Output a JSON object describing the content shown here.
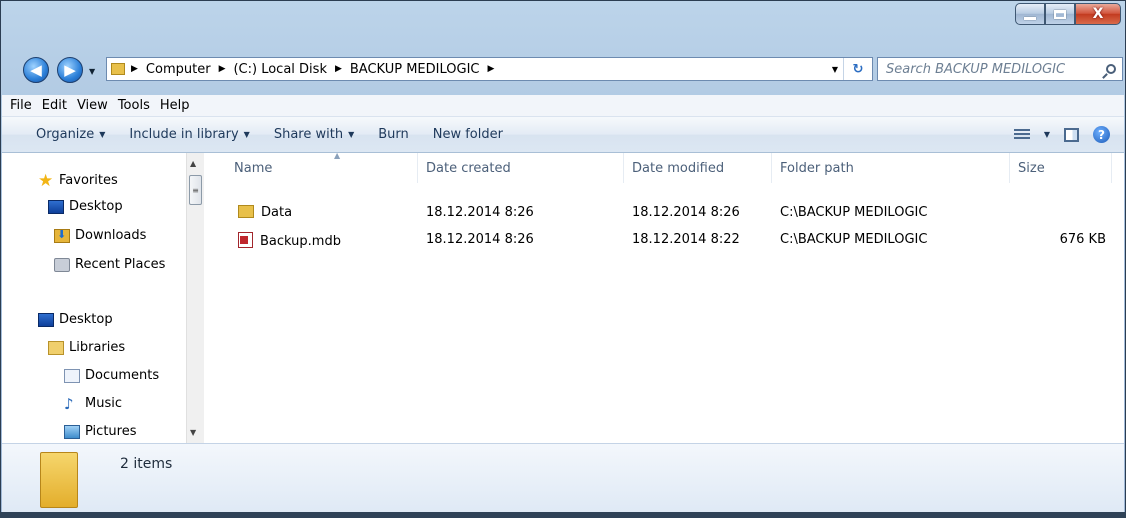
{
  "window": {
    "caption_buttons": {
      "minimize_icon": "minimize-icon",
      "maximize_icon": "maximize-icon",
      "close_label": "X"
    }
  },
  "nav": {
    "back_glyph": "◀",
    "forward_glyph": "▶",
    "breadcrumbs": [
      "Computer",
      "(C:) Local Disk",
      "BACKUP MEDILOGIC"
    ],
    "search_placeholder": "Search BACKUP MEDILOGIC"
  },
  "menu": [
    "File",
    "Edit",
    "View",
    "Tools",
    "Help"
  ],
  "toolbar": {
    "organize": "Organize",
    "include": "Include in library",
    "share": "Share with",
    "burn": "Burn",
    "new_folder": "New folder",
    "help": "?"
  },
  "navpane": {
    "favorites": "Favorites",
    "fav_desktop": "Desktop",
    "downloads": "Downloads",
    "recent": "Recent Places",
    "desktop": "Desktop",
    "libraries": "Libraries",
    "documents": "Documents",
    "music": "Music",
    "pictures": "Pictures"
  },
  "columns": {
    "name": "Name",
    "date_created": "Date created",
    "date_modified": "Date modified",
    "folder_path": "Folder path",
    "size": "Size"
  },
  "files": [
    {
      "name": "Data",
      "type": "folder",
      "created": "18.12.2014 8:26",
      "modified": "18.12.2014 8:26",
      "path": "C:\\BACKUP MEDILOGIC",
      "size": ""
    },
    {
      "name": "Backup.mdb",
      "type": "mdb",
      "created": "18.12.2014 8:26",
      "modified": "18.12.2014 8:22",
      "path": "C:\\BACKUP MEDILOGIC",
      "size": "676 KB"
    }
  ],
  "status": {
    "count": "2 items"
  },
  "colors": {
    "accent": "#1e395b",
    "folder": "#e8c04a",
    "close": "#c23a1f"
  }
}
